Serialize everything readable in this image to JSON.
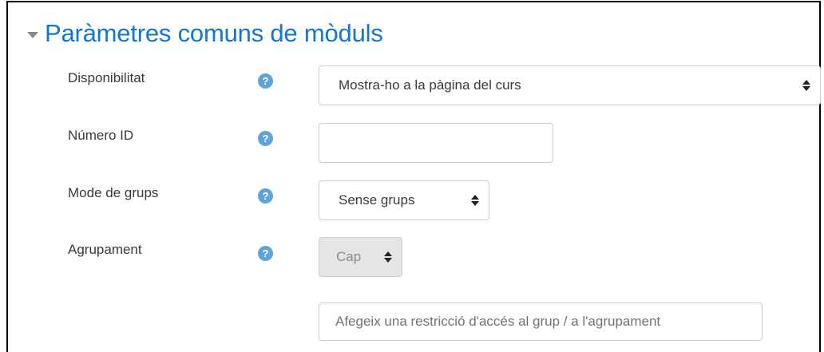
{
  "section": {
    "title": "Paràmetres comuns de mòduls"
  },
  "fields": {
    "availability": {
      "label": "Disponibilitat",
      "value": "Mostra-ho a la pàgina del curs"
    },
    "idnumber": {
      "label": "Número ID",
      "value": ""
    },
    "groupmode": {
      "label": "Mode de grups",
      "value": "Sense grups"
    },
    "grouping": {
      "label": "Agrupament",
      "value": "Cap"
    }
  },
  "help_icon_glyph": "?",
  "restriction_button": {
    "label": "Afegeix una restricció d'accés al grup / a l'agrupament"
  },
  "colors": {
    "title": "#1177d1",
    "help_icon": "#5fa3dc",
    "disabled_bg": "#e5e5e5"
  }
}
